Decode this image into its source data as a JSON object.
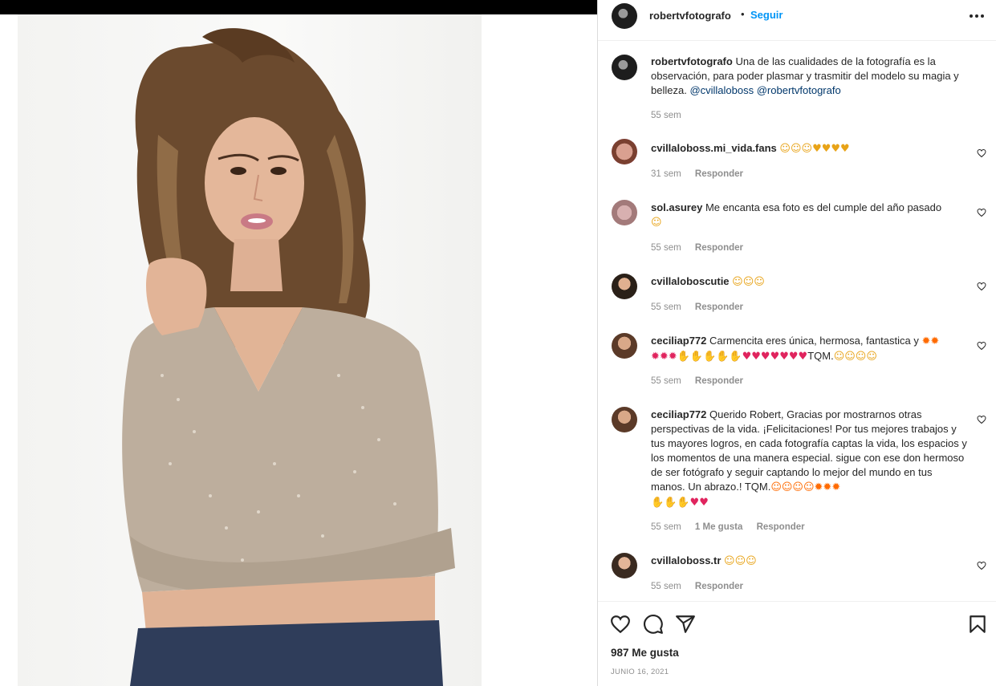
{
  "post": {
    "author": "robertvfotografo",
    "dot": "•",
    "follow_label": "Seguir",
    "more_icon": "more-horizontal-icon",
    "caption": {
      "user": "robertvfotografo",
      "text": "Una de las cualidades de la fotografía es la observación, para poder plasmar y trasmitir del modelo su magia y belleza.",
      "mention1": "@cvillaloboss",
      "mention2": "@robertvfotografo",
      "time": "55 sem"
    }
  },
  "comments": [
    {
      "user": "cvillaloboss.mi_vida.fans",
      "text": "",
      "emoji": "☺☺☺♥♥♥♥",
      "time": "31 sem",
      "likes": "",
      "reply": "Responder"
    },
    {
      "user": "sol.asurey",
      "text": "Me encanta esa foto es del cumple del año pasado",
      "emoji": "☺",
      "time": "55 sem",
      "likes": "",
      "reply": "Responder"
    },
    {
      "user": "cvillaloboscutie",
      "text": "",
      "emoji": "☺☺☺",
      "time": "55 sem",
      "likes": "",
      "reply": "Responder"
    },
    {
      "user": "ceciliap772",
      "text": "Carmencita eres única, hermosa, fantastica y",
      "emoji_line1": "✹✹",
      "emoji_line2": "✹✹✹✋✋✋✋✋♥♥♥♥♥♥♥",
      "suffix": "TQM.",
      "emoji_line3": "☺☺☺☺",
      "time": "55 sem",
      "likes": "",
      "reply": "Responder"
    },
    {
      "user": "ceciliap772",
      "text": "Querido Robert, Gracias por mostrarnos otras perspectivas de la vida. ¡Felicitaciones! Por tus mejores trabajos y tus mayores logros, en cada fotografía captas la vida, los espacios y los momentos de una manera especial. sigue con ese don hermoso de ser fotógrafo y seguir captando lo mejor del mundo en tus manos. Un abrazo.! TQM.",
      "emoji_line1": "☺☺☺☺✹✹✹",
      "emoji_line2": "✋✋✋♥♥",
      "time": "55 sem",
      "likes": "1 Me gusta",
      "reply": "Responder"
    },
    {
      "user": "cvillaloboss.tr",
      "text": "",
      "emoji": "☺☺☺",
      "time": "55 sem",
      "likes": "",
      "reply": "Responder"
    }
  ],
  "footer": {
    "likes": "987 Me gusta",
    "date": "JUNIO 16, 2021",
    "icons": [
      "heart-icon",
      "comment-icon",
      "share-icon",
      "bookmark-icon"
    ]
  },
  "colors": {
    "accent": "#0095f6",
    "mention": "#00376b",
    "meta": "#8e8e8e"
  }
}
